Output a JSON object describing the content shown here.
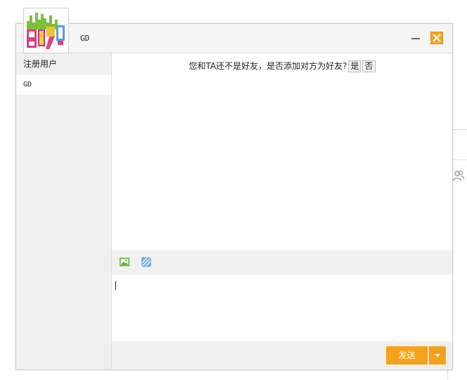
{
  "window": {
    "title": "GD"
  },
  "sidebar": {
    "header": "注册用户",
    "items": [
      {
        "label": "GD",
        "selected": true
      }
    ]
  },
  "chat": {
    "notice": "您和TA还不是好友，是否添加对方为好友?",
    "yes_label": "是",
    "no_label": "否"
  },
  "toolbar": {
    "icons": [
      "image-icon",
      "screenshot-icon"
    ]
  },
  "footer": {
    "send_label": "发送"
  },
  "colors": {
    "accent": "#f7a21b",
    "close_button": "#f5a623",
    "sidebar_bg": "#f0f0f0",
    "toolbar_bg": "#f1f1f1"
  }
}
